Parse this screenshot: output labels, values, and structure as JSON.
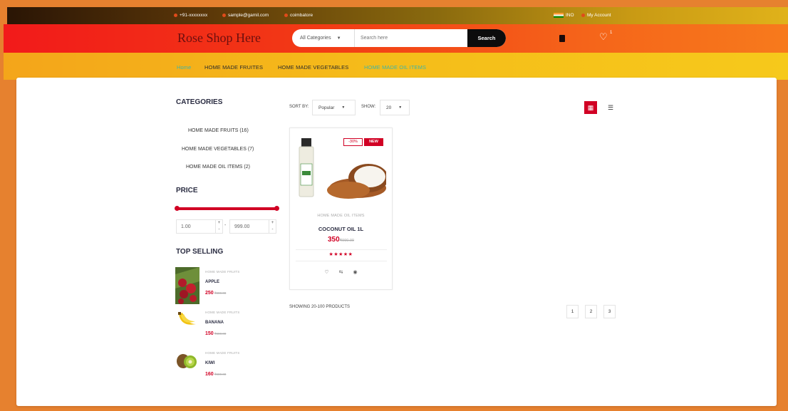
{
  "topbar": {
    "phone": "+91-xxxxxxxx",
    "email": "sample@gamil.com",
    "location": "coimbatore",
    "currency": "INO",
    "account": "My Account"
  },
  "header": {
    "logo": "Rose Shop Here",
    "category_select": "All Categories",
    "search_placeholder": "Search here",
    "search_button": "Search",
    "wishlist_count": "1"
  },
  "nav": {
    "items": [
      "Home",
      "HOME MADE FRUITES",
      "HOME MADE VEGETABLES",
      "HOME MADE OIL ITEMS"
    ]
  },
  "sidebar": {
    "categories_title": "CATEGORIES",
    "categories": [
      "HOME MADE FRUITS (16)",
      "HOME MADE VEGETABLES (7)",
      "HOME MADE OIL ITEMS (2)"
    ],
    "price_title": "PRICE",
    "price_min": "1.00",
    "price_max": "999.00",
    "top_selling_title": "TOP SELLING",
    "top_selling": [
      {
        "category": "HOME MADE FRUITS",
        "name": "APPLE",
        "price": "250",
        "old_price": "₹990.00"
      },
      {
        "category": "HOME MADE FRUITS",
        "name": "BANANA",
        "price": "150",
        "old_price": "₹990.00"
      },
      {
        "category": "HOME MADE FRUITS",
        "name": "KIWI",
        "price": "160",
        "old_price": "₹990.00"
      }
    ]
  },
  "toolbar": {
    "sort_label": "SORT BY:",
    "sort_value": "Popular",
    "show_label": "SHOW:",
    "show_value": "20"
  },
  "product": {
    "sale_badge": "-30%",
    "new_badge": "NEW",
    "category": "HOME MADE OIL ITEMS",
    "name": "COCONUT OIL 1L",
    "price": "350",
    "old_price": "₹990.00",
    "stars": "★★★★★"
  },
  "footer": {
    "showing": "SHOWING 20-100 PRODUCTS",
    "pages": [
      "1",
      "2",
      "3"
    ]
  },
  "colors": {
    "accent": "#d10024",
    "header_red": "#f21a1a",
    "nav_yellow": "#f5bd1a",
    "active_link": "#3fb5a8"
  }
}
